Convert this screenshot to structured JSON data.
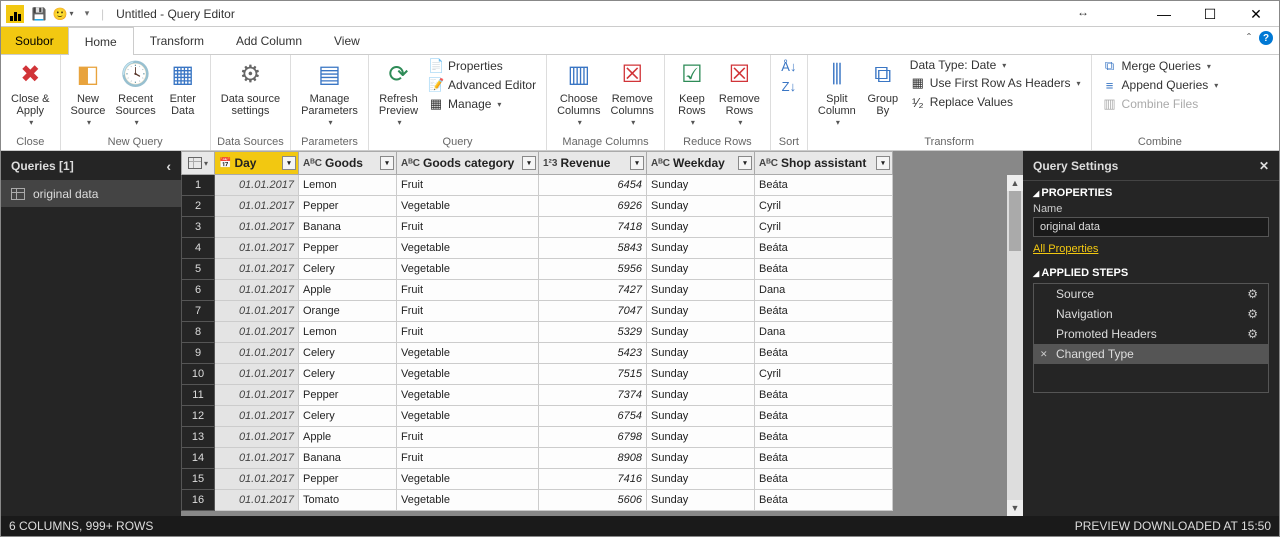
{
  "title": "Untitled - Query Editor",
  "win": {
    "min": "—",
    "max": "☐",
    "close": "✕"
  },
  "tabs": {
    "file": "Soubor",
    "home": "Home",
    "transform": "Transform",
    "add": "Add Column",
    "view": "View"
  },
  "ribbon": {
    "close": {
      "label": "Close &\nApply",
      "group": "Close"
    },
    "newquery": {
      "new": "New\nSource",
      "recent": "Recent\nSources",
      "enter": "Enter\nData",
      "group": "New Query"
    },
    "ds": {
      "label": "Data source\nsettings",
      "group": "Data Sources"
    },
    "params": {
      "label": "Manage\nParameters",
      "group": "Parameters"
    },
    "query": {
      "refresh": "Refresh\nPreview",
      "props": "Properties",
      "adv": "Advanced Editor",
      "manage": "Manage",
      "group": "Query"
    },
    "cols": {
      "choose": "Choose\nColumns",
      "remove": "Remove\nColumns",
      "group": "Manage Columns"
    },
    "rows": {
      "keep": "Keep\nRows",
      "remove": "Remove\nRows",
      "group": "Reduce Rows"
    },
    "sort": {
      "group": "Sort"
    },
    "transform": {
      "split": "Split\nColumn",
      "group": "Group\nBy",
      "dtype": "Data Type: Date",
      "firstrow": "Use First Row As Headers",
      "replace": "Replace Values",
      "grouplabel": "Transform"
    },
    "combine": {
      "merge": "Merge Queries",
      "append": "Append Queries",
      "files": "Combine Files",
      "group": "Combine"
    }
  },
  "queries": {
    "title": "Queries [1]",
    "item": "original data"
  },
  "columns": [
    "Day",
    "Goods",
    "Goods category",
    "Revenue",
    "Weekday",
    "Shop assistant"
  ],
  "coltypes": [
    "📅",
    "AᴮC",
    "AᴮC",
    "1²3",
    "AᴮC",
    "AᴮC"
  ],
  "rows": [
    [
      "01.01.2017",
      "Lemon",
      "Fruit",
      "6454",
      "Sunday",
      "Beáta"
    ],
    [
      "01.01.2017",
      "Pepper",
      "Vegetable",
      "6926",
      "Sunday",
      "Cyril"
    ],
    [
      "01.01.2017",
      "Banana",
      "Fruit",
      "7418",
      "Sunday",
      "Cyril"
    ],
    [
      "01.01.2017",
      "Pepper",
      "Vegetable",
      "5843",
      "Sunday",
      "Beáta"
    ],
    [
      "01.01.2017",
      "Celery",
      "Vegetable",
      "5956",
      "Sunday",
      "Beáta"
    ],
    [
      "01.01.2017",
      "Apple",
      "Fruit",
      "7427",
      "Sunday",
      "Dana"
    ],
    [
      "01.01.2017",
      "Orange",
      "Fruit",
      "7047",
      "Sunday",
      "Beáta"
    ],
    [
      "01.01.2017",
      "Lemon",
      "Fruit",
      "5329",
      "Sunday",
      "Dana"
    ],
    [
      "01.01.2017",
      "Celery",
      "Vegetable",
      "5423",
      "Sunday",
      "Beáta"
    ],
    [
      "01.01.2017",
      "Celery",
      "Vegetable",
      "7515",
      "Sunday",
      "Cyril"
    ],
    [
      "01.01.2017",
      "Pepper",
      "Vegetable",
      "7374",
      "Sunday",
      "Beáta"
    ],
    [
      "01.01.2017",
      "Celery",
      "Vegetable",
      "6754",
      "Sunday",
      "Beáta"
    ],
    [
      "01.01.2017",
      "Apple",
      "Fruit",
      "6798",
      "Sunday",
      "Beáta"
    ],
    [
      "01.01.2017",
      "Banana",
      "Fruit",
      "8908",
      "Sunday",
      "Beáta"
    ],
    [
      "01.01.2017",
      "Pepper",
      "Vegetable",
      "7416",
      "Sunday",
      "Beáta"
    ],
    [
      "01.01.2017",
      "Tomato",
      "Vegetable",
      "5606",
      "Sunday",
      "Beáta"
    ]
  ],
  "settings": {
    "title": "Query Settings",
    "props": "PROPERTIES",
    "name": "Name",
    "name_val": "original data",
    "allprops": "All Properties",
    "applied": "APPLIED STEPS",
    "steps": [
      "Source",
      "Navigation",
      "Promoted Headers",
      "Changed Type"
    ]
  },
  "status": {
    "left": "6 COLUMNS, 999+ ROWS",
    "right": "PREVIEW DOWNLOADED AT 15:50"
  }
}
